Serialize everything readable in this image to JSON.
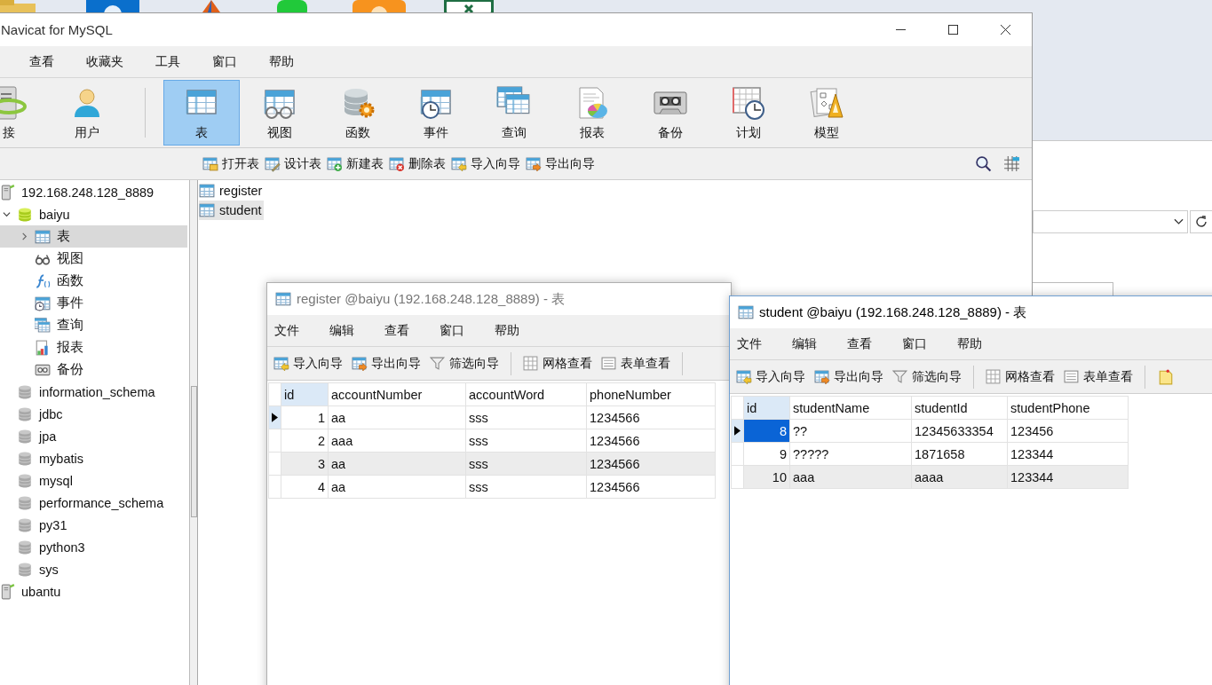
{
  "main_window": {
    "title": "Navicat for MySQL",
    "menu": [
      "查看",
      "收藏夹",
      "工具",
      "窗口",
      "帮助"
    ],
    "toolbar": [
      {
        "label": "接",
        "kind": "connection",
        "selected": false
      },
      {
        "label": "用户",
        "kind": "user",
        "selected": false
      },
      {
        "label": "表",
        "kind": "table",
        "selected": true
      },
      {
        "label": "视图",
        "kind": "view",
        "selected": false
      },
      {
        "label": "函数",
        "kind": "function",
        "selected": false
      },
      {
        "label": "事件",
        "kind": "event",
        "selected": false
      },
      {
        "label": "查询",
        "kind": "query",
        "selected": false
      },
      {
        "label": "报表",
        "kind": "report",
        "selected": false
      },
      {
        "label": "备份",
        "kind": "backup",
        "selected": false
      },
      {
        "label": "计划",
        "kind": "schedule",
        "selected": false
      },
      {
        "label": "模型",
        "kind": "model",
        "selected": false
      }
    ],
    "object_toolbar": [
      {
        "label": "打开表",
        "kind": "open"
      },
      {
        "label": "设计表",
        "kind": "design"
      },
      {
        "label": "新建表",
        "kind": "new"
      },
      {
        "label": "删除表",
        "kind": "delete"
      },
      {
        "label": "导入向导",
        "kind": "import"
      },
      {
        "label": "导出向导",
        "kind": "export"
      }
    ],
    "tree": [
      {
        "label": "192.168.248.128_8889",
        "kind": "connection",
        "selected": false,
        "children": [
          {
            "label": "baiyu",
            "kind": "database",
            "selected": false,
            "expanded": true,
            "children": [
              {
                "label": "表",
                "kind": "tables",
                "selected": true,
                "expanded": false
              },
              {
                "label": "视图",
                "kind": "views",
                "selected": false
              },
              {
                "label": "函数",
                "kind": "functions",
                "selected": false
              },
              {
                "label": "事件",
                "kind": "events",
                "selected": false
              },
              {
                "label": "查询",
                "kind": "queries",
                "selected": false
              },
              {
                "label": "报表",
                "kind": "reports",
                "selected": false
              },
              {
                "label": "备份",
                "kind": "backups",
                "selected": false
              }
            ]
          },
          {
            "label": "information_schema",
            "kind": "database",
            "selected": false
          },
          {
            "label": "jdbc",
            "kind": "database",
            "selected": false
          },
          {
            "label": "jpa",
            "kind": "database",
            "selected": false
          },
          {
            "label": "mybatis",
            "kind": "database",
            "selected": false
          },
          {
            "label": "mysql",
            "kind": "database",
            "selected": false
          },
          {
            "label": "performance_schema",
            "kind": "database",
            "selected": false
          },
          {
            "label": "py31",
            "kind": "database",
            "selected": false
          },
          {
            "label": "python3",
            "kind": "database",
            "selected": false
          },
          {
            "label": "sys",
            "kind": "database",
            "selected": false
          }
        ]
      },
      {
        "label": "ubantu",
        "kind": "connection",
        "selected": false
      }
    ],
    "tables": [
      {
        "label": "register",
        "selected": false
      },
      {
        "label": "student",
        "selected": true
      }
    ]
  },
  "register_window": {
    "title": "register @baiyu (192.168.248.128_8889) - 表",
    "active": false,
    "menu": [
      "文件",
      "编辑",
      "查看",
      "窗口",
      "帮助"
    ],
    "toolbar": [
      {
        "label": "导入向导",
        "kind": "import"
      },
      {
        "label": "导出向导",
        "kind": "export"
      },
      {
        "label": "筛选向导",
        "kind": "filter"
      },
      {
        "label": "网格查看",
        "kind": "grid"
      },
      {
        "label": "表单查看",
        "kind": "form"
      }
    ],
    "columns": [
      {
        "label": "id",
        "selected": true
      },
      {
        "label": "accountNumber",
        "selected": false
      },
      {
        "label": "accountWord",
        "selected": false
      },
      {
        "label": "phoneNumber",
        "selected": false
      }
    ],
    "rows": [
      {
        "cells": [
          "1",
          "aa",
          "sss",
          "1234566"
        ],
        "current": true,
        "selected": false,
        "shaded": false
      },
      {
        "cells": [
          "2",
          "aaa",
          "sss",
          "1234566"
        ],
        "current": false,
        "selected": false,
        "shaded": false
      },
      {
        "cells": [
          "3",
          "aa",
          "sss",
          "1234566"
        ],
        "current": false,
        "selected": false,
        "shaded": true
      },
      {
        "cells": [
          "4",
          "aa",
          "sss",
          "1234566"
        ],
        "current": false,
        "selected": false,
        "shaded": false
      }
    ]
  },
  "student_window": {
    "title": "student @baiyu (192.168.248.128_8889) - 表",
    "active": true,
    "menu": [
      "文件",
      "编辑",
      "查看",
      "窗口",
      "帮助"
    ],
    "toolbar": [
      {
        "label": "导入向导",
        "kind": "import"
      },
      {
        "label": "导出向导",
        "kind": "export"
      },
      {
        "label": "筛选向导",
        "kind": "filter"
      },
      {
        "label": "网格查看",
        "kind": "grid"
      },
      {
        "label": "表单查看",
        "kind": "form"
      }
    ],
    "columns": [
      {
        "label": "id",
        "selected": true
      },
      {
        "label": "studentName",
        "selected": false
      },
      {
        "label": "studentId",
        "selected": false
      },
      {
        "label": "studentPhone",
        "selected": false
      }
    ],
    "rows": [
      {
        "cells": [
          "8",
          "??",
          "12345633354",
          "123456"
        ],
        "current": true,
        "selected": true,
        "shaded": false
      },
      {
        "cells": [
          "9",
          "?????",
          "1871658",
          "123344"
        ],
        "current": false,
        "selected": false,
        "shaded": false
      },
      {
        "cells": [
          "10",
          "aaa",
          "aaaa",
          "123344"
        ],
        "current": false,
        "selected": false,
        "shaded": true
      }
    ]
  }
}
